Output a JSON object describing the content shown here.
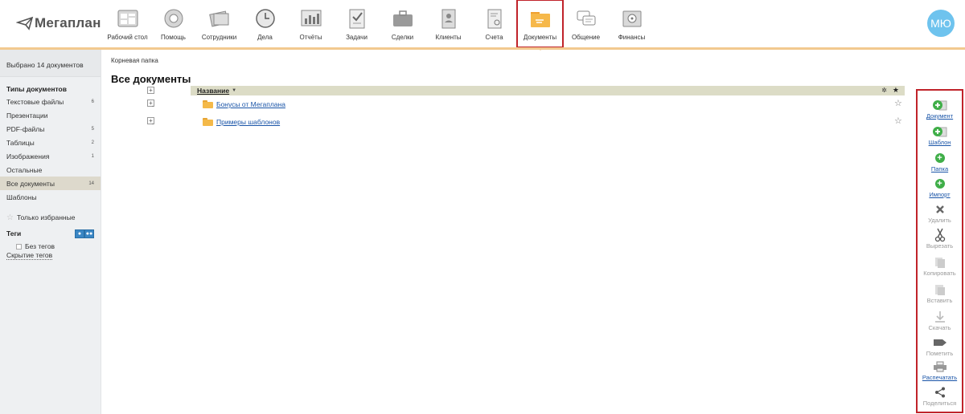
{
  "app": {
    "logo_text": "Мегаплан",
    "avatar_initials": "МЮ"
  },
  "nav": {
    "items": [
      {
        "label": "Рабочий стол",
        "icon": "desktop-icon"
      },
      {
        "label": "Помощь",
        "icon": "help-lifebuoy-icon"
      },
      {
        "label": "Сотрудники",
        "icon": "employees-icon"
      },
      {
        "label": "Дела",
        "icon": "clock-icon"
      },
      {
        "label": "Отчёты",
        "icon": "reports-chart-icon"
      },
      {
        "label": "Задачи",
        "icon": "tasks-checklist-icon"
      },
      {
        "label": "Сделки",
        "icon": "briefcase-icon"
      },
      {
        "label": "Клиенты",
        "icon": "clients-book-icon"
      },
      {
        "label": "Счета",
        "icon": "invoice-icon"
      },
      {
        "label": "Документы",
        "icon": "documents-folder-icon"
      },
      {
        "label": "Общение",
        "icon": "chat-icon"
      },
      {
        "label": "Финансы",
        "icon": "safe-icon"
      }
    ],
    "active": "Документы"
  },
  "sidebar": {
    "selected_summary": "Выбрано 14 документов",
    "types_title": "Типы документов",
    "items": [
      {
        "label": "Текстовые файлы",
        "count": "6"
      },
      {
        "label": "Презентации",
        "count": ""
      },
      {
        "label": "PDF-файлы",
        "count": "5"
      },
      {
        "label": "Таблицы",
        "count": "2"
      },
      {
        "label": "Изображения",
        "count": "1"
      },
      {
        "label": "Остальные",
        "count": ""
      },
      {
        "label": "Все документы",
        "count": "14"
      },
      {
        "label": "Шаблоны",
        "count": ""
      }
    ],
    "favorites_label": "Только избранные",
    "tags_title": "Теги",
    "no_tags_label": "Без тегов",
    "hide_tags_label": "Скрытие тегов"
  },
  "main": {
    "breadcrumb": "Корневая папка",
    "title": "Все документы",
    "column_name": "Название",
    "rows": [
      {
        "name": "Бонусы от Мегаплана"
      },
      {
        "name": "Примеры шаблонов"
      }
    ]
  },
  "actions": [
    {
      "label": "Документ",
      "icon": "add-document-icon",
      "enabled": true
    },
    {
      "label": "Шаблон",
      "icon": "add-template-icon",
      "enabled": true
    },
    {
      "label": "Папка",
      "icon": "add-folder-icon",
      "enabled": true
    },
    {
      "label": "Импорт",
      "icon": "import-icon",
      "enabled": true
    },
    {
      "label": "Удалить",
      "icon": "delete-x-icon",
      "enabled": false
    },
    {
      "label": "Вырезать",
      "icon": "scissors-icon",
      "enabled": false
    },
    {
      "label": "Копировать",
      "icon": "copy-icon",
      "enabled": false
    },
    {
      "label": "Вставить",
      "icon": "paste-icon",
      "enabled": false
    },
    {
      "label": "Скачать",
      "icon": "download-icon",
      "enabled": false
    },
    {
      "label": "Пометить",
      "icon": "tag-mark-icon",
      "enabled": false
    },
    {
      "label": "Распечатать",
      "icon": "printer-icon",
      "enabled": true
    },
    {
      "label": "Поделиться",
      "icon": "share-icon",
      "enabled": false
    }
  ],
  "colors": {
    "accent_orange": "#f2c98f",
    "highlight_red": "#c0232a",
    "link_blue": "#1a55a8",
    "avatar_blue": "#6ec3ee"
  }
}
